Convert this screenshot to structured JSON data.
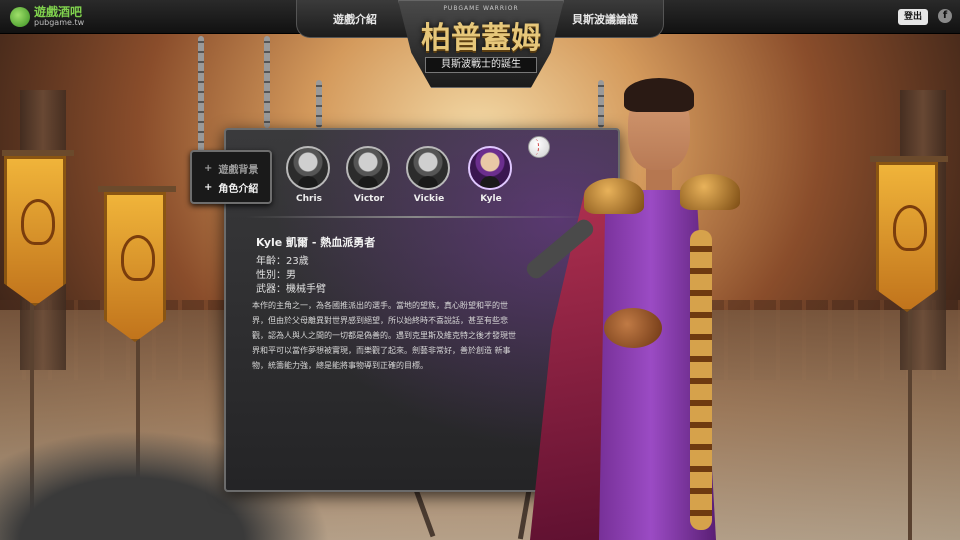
{
  "site": {
    "logo_text": "遊戲酒吧",
    "logo_sub": "pubgame.tw"
  },
  "nav": {
    "left_label": "遊戲介紹",
    "right_label": "貝斯波議論證"
  },
  "title": {
    "eyebrow": "PUBGAME WARRIOR",
    "main": "柏普蓋姆",
    "subtitle": "貝斯波戰士的誕生"
  },
  "header_actions": {
    "logout_label": "登出",
    "facebook_icon": "facebook-icon"
  },
  "side_menu": {
    "items": [
      {
        "label": "遊戲背景",
        "marker": "+"
      },
      {
        "label": "角色介紹",
        "marker": "+"
      }
    ]
  },
  "characters": [
    {
      "name": "Chris",
      "active": false
    },
    {
      "name": "Victor",
      "active": false
    },
    {
      "name": "Vickie",
      "active": false
    },
    {
      "name": "Kyle",
      "active": true
    }
  ],
  "profile": {
    "heading": "Kyle 凱爾 - 熱血派勇者",
    "age": "年齡：23歲",
    "gender": "性別：男",
    "weapon": "武器：機械手臂",
    "bio": "本作的主角之一，為各國推派出的選手。當地的望族，真心盼望和平的世界，但由於父母離異對世界感到絕望，所以始終時不喜說話，甚至有些悲觀，認為人與人之間的一切都是偽善的。遇到克里斯及維克特之後才發現世界和平可以當作夢想被實現，而樂觀了起來。劍藝非常好，善於創造 新事物，統籌能力強，總是能將事物導到正確的目標。"
  },
  "colors": {
    "accent_gold": "#e6c77a",
    "hero_purple": "#9b4bc4",
    "logo_green": "#7fd04d"
  }
}
